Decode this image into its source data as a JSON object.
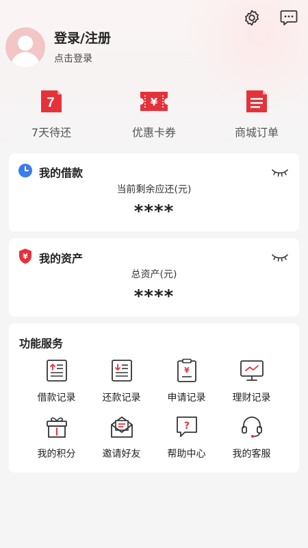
{
  "profile": {
    "title": "登录/注册",
    "subtitle": "点击登录"
  },
  "header_icons": [
    "gear-icon",
    "message-icon"
  ],
  "quick": [
    {
      "label": "7天待还",
      "icon": "calendar-7-icon",
      "badge": "7"
    },
    {
      "label": "优惠卡券",
      "icon": "coupon-icon",
      "badge": "¥"
    },
    {
      "label": "商城订单",
      "icon": "order-list-icon"
    }
  ],
  "loan_card": {
    "title": "我的借款",
    "subtitle": "当前剩余应还(元)",
    "value": "****"
  },
  "asset_card": {
    "title": "我的资产",
    "subtitle": "总资产(元)",
    "value": "****"
  },
  "services": {
    "title": "功能服务",
    "items": [
      {
        "label": "借款记录",
        "icon": "borrow-record-icon"
      },
      {
        "label": "还款记录",
        "icon": "repay-record-icon"
      },
      {
        "label": "申请记录",
        "icon": "apply-record-icon"
      },
      {
        "label": "理财记录",
        "icon": "finance-record-icon"
      },
      {
        "label": "我的积分",
        "icon": "gift-icon"
      },
      {
        "label": "邀请好友",
        "icon": "invite-icon"
      },
      {
        "label": "帮助中心",
        "icon": "help-icon"
      },
      {
        "label": "我的客服",
        "icon": "headset-icon"
      }
    ]
  },
  "colors": {
    "accent": "#e5323a",
    "clock_blue": "#3d7cf0"
  }
}
